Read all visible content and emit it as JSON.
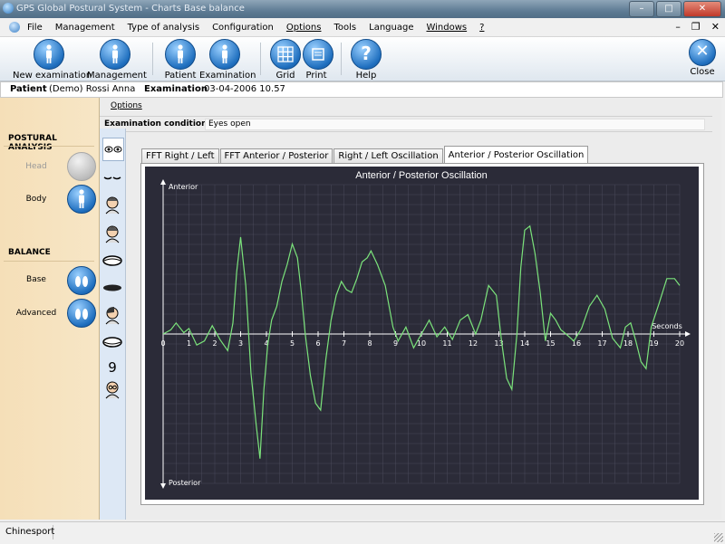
{
  "window": {
    "title": "GPS Global Postural System - Charts Base balance"
  },
  "menu": {
    "items": [
      "File",
      "Management",
      "Type of analysis",
      "Configuration",
      "Options",
      "Tools",
      "Language",
      "Windows",
      "?"
    ]
  },
  "toolbar": {
    "new_examination": "New examination",
    "management": "Management",
    "patient": "Patient",
    "examination": "Examination",
    "grid": "Grid",
    "print": "Print",
    "help": "Help",
    "close": "Close"
  },
  "patient_bar": {
    "patient_label": "Patient",
    "patient_value": "(Demo) Rossi Anna",
    "exam_label": "Examination",
    "exam_value": "03-04-2006 10.57"
  },
  "left_panel": {
    "postural_title": "POSTURAL ANALYSIS",
    "head": "Head",
    "body": "Body",
    "balance_title": "BALANCE",
    "base": "Base",
    "advanced": "Advanced"
  },
  "options_label": "Options",
  "exam_conditions": {
    "label": "Examination conditions:",
    "value": "Eyes open"
  },
  "tabs": [
    {
      "label": "FFT Right / Left",
      "active": false
    },
    {
      "label": "FFT Anterior / Posterior",
      "active": false
    },
    {
      "label": "Right / Left Oscillation",
      "active": false
    },
    {
      "label": "Anterior / Posterior Oscillation",
      "active": true
    }
  ],
  "statusbar": {
    "text": "Chinesport"
  },
  "colors": {
    "chart_bg": "#2b2b38",
    "grid": "#4a4a5a",
    "line": "#7be37b",
    "axis": "#ffffff",
    "accent": "#1f6fbf"
  },
  "chart_data": {
    "type": "line",
    "title": "Anterior / Posterior Oscillation",
    "ylabel_top": "Anterior",
    "ylabel_bottom": "Posterior",
    "xlabel": "Seconds",
    "xlim": [
      0,
      20
    ],
    "ylim": [
      -100,
      100
    ],
    "ticks": [
      0,
      1,
      2,
      3,
      4,
      5,
      6,
      7,
      8,
      9,
      10,
      11,
      12,
      13,
      14,
      15,
      16,
      17,
      18,
      19,
      20
    ],
    "grid": true,
    "series": [
      {
        "x": [
          0,
          0.3,
          0.5,
          0.8,
          1,
          1.3,
          1.6,
          1.9,
          2.2,
          2.5,
          2.7,
          2.85,
          3,
          3.2,
          3.4,
          3.6,
          3.75,
          3.9,
          4.05,
          4.2,
          4.4,
          4.6,
          4.8,
          5,
          5.2,
          5.35,
          5.5,
          5.7,
          5.9,
          6.1,
          6.3,
          6.5,
          6.7,
          6.9,
          7.1,
          7.3,
          7.5,
          7.7,
          7.9,
          8.05,
          8.3,
          8.6,
          8.9,
          9.1,
          9.4,
          9.7,
          10,
          10.3,
          10.6,
          10.9,
          11.2,
          11.5,
          11.8,
          12.1,
          12.3,
          12.6,
          12.9,
          13.1,
          13.3,
          13.5,
          13.7,
          13.85,
          14,
          14.2,
          14.4,
          14.6,
          14.8,
          15,
          15.2,
          15.4,
          15.6,
          15.9,
          16.2,
          16.5,
          16.8,
          17.1,
          17.4,
          17.7,
          17.9,
          18.1,
          18.3,
          18.5,
          18.7,
          18.9,
          19.2,
          19.5,
          19.8,
          20
        ],
        "y": [
          0,
          3,
          8,
          1,
          4,
          -8,
          -5,
          6,
          -4,
          -12,
          8,
          45,
          70,
          35,
          -28,
          -65,
          -90,
          -40,
          -8,
          10,
          20,
          38,
          50,
          65,
          55,
          30,
          0,
          -30,
          -50,
          -55,
          -18,
          10,
          28,
          38,
          32,
          30,
          40,
          52,
          55,
          60,
          50,
          35,
          5,
          -5,
          5,
          -10,
          0,
          10,
          -2,
          5,
          -4,
          10,
          14,
          0,
          10,
          35,
          28,
          -5,
          -32,
          -40,
          0,
          48,
          75,
          78,
          58,
          30,
          -5,
          15,
          10,
          3,
          0,
          -5,
          4,
          20,
          28,
          18,
          -3,
          -10,
          5,
          8,
          -5,
          -20,
          -25,
          5,
          22,
          40,
          40,
          35
        ]
      }
    ]
  }
}
